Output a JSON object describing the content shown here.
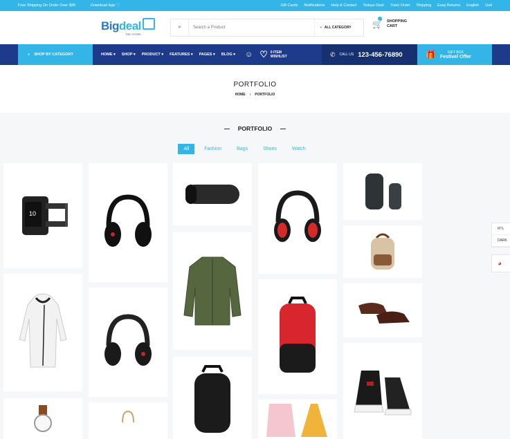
{
  "topbar": {
    "shipping": "Free Shipping On Order Over $99",
    "download": "Download App",
    "download_icons": "‘’‚‛",
    "links": [
      "Gift Cards",
      "Notifications",
      "Help & Contact",
      "Todays Deal",
      "Track Order",
      "Shipping",
      "Easy Returns",
      "English",
      "Usd"
    ]
  },
  "header": {
    "logo_brand_a": "Big",
    "logo_brand_b": "deal",
    "logo_tagline": "THE STORE",
    "search_placeholder": "Search a Product",
    "category_label": "ALL CATEGORY",
    "cart_label_1": "SHOPPING",
    "cart_label_2": "CART"
  },
  "nav": {
    "shop_by_category": "SHOP BY CATEGORY",
    "menu": [
      "HOME",
      "SHOP",
      "PRODUCT",
      "FEATURES",
      "PAGES",
      "BLOG"
    ],
    "wishlist_count": "0 ITEM",
    "wishlist_label": "WISHLIST",
    "call_label": "CALL US",
    "phone": "123-456-76890",
    "gift_label": "GIFT BOX",
    "gift_offer": "Festivel Offer"
  },
  "banner": {
    "title": "PORTFOLIO",
    "crumb_home": "HOME",
    "crumb_current": "PORTFOLIO"
  },
  "section": {
    "title": "PORTFOLIO"
  },
  "filters": [
    "All",
    "Fashion",
    "Bags",
    "Shoes",
    "Watch"
  ],
  "side_panel": [
    "RTL",
    "DARK"
  ],
  "colors": {
    "accent": "#33b5e8",
    "navy": "#1e3a8a",
    "brand_blue": "#2b78c5"
  }
}
